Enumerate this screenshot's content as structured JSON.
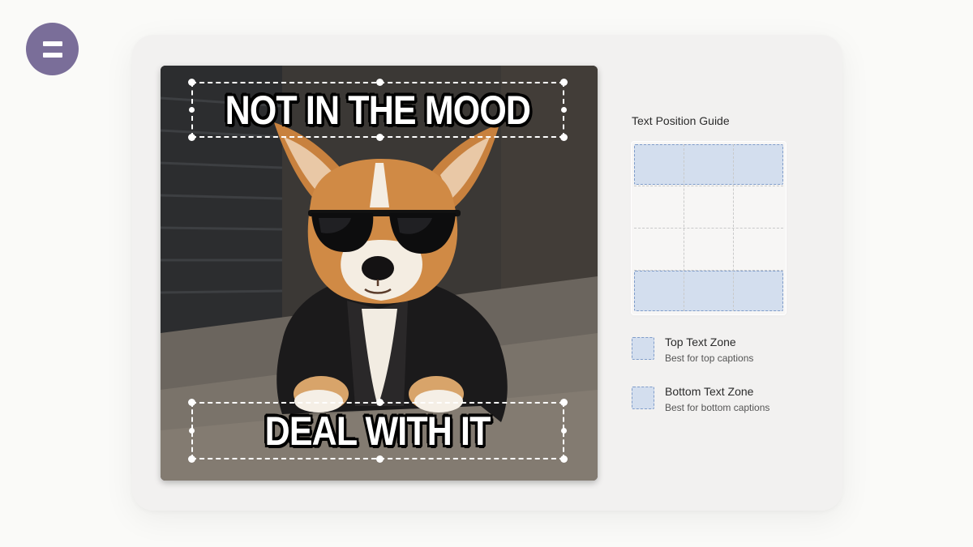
{
  "menu": {
    "icon": "hamburger-icon",
    "color": "#7a6e99"
  },
  "meme": {
    "top_text": "NOT IN THE MOOD",
    "bottom_text": "DEAL WITH IT"
  },
  "guide": {
    "title": "Text Position Guide",
    "zone_color": "#d3deee",
    "zone_border_color": "#7f9cc9",
    "legend": [
      {
        "label": "Top Text Zone",
        "description": "Best for top captions"
      },
      {
        "label": "Bottom Text Zone",
        "description": "Best for bottom captions"
      }
    ]
  }
}
